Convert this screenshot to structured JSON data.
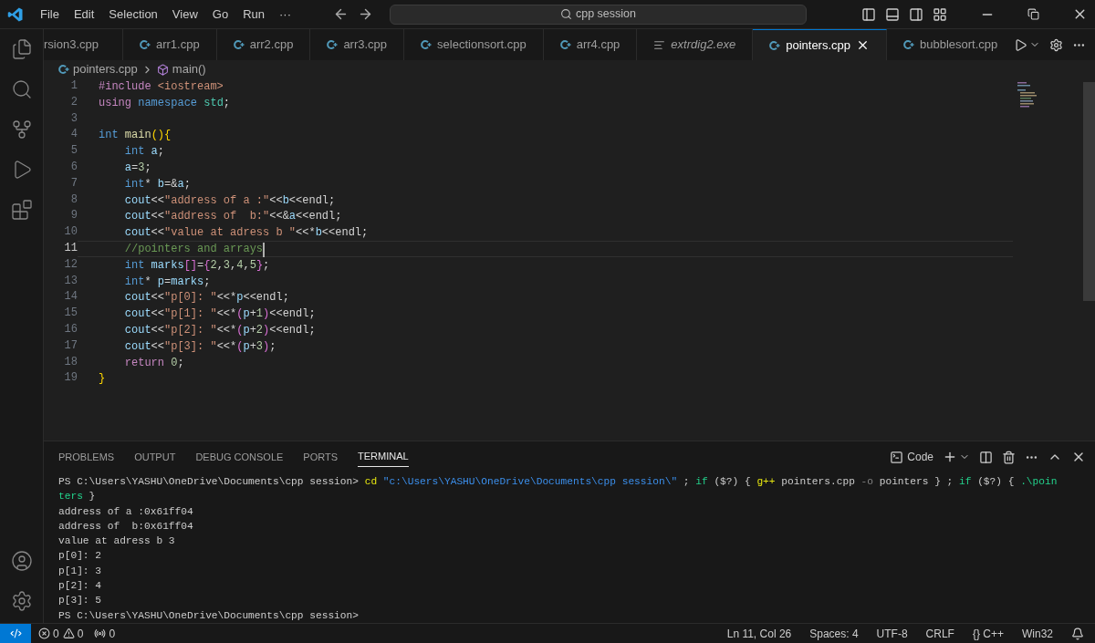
{
  "title_bar": {
    "menus": [
      "File",
      "Edit",
      "Selection",
      "View",
      "Go",
      "Run",
      "···"
    ],
    "search": "cpp session"
  },
  "tabs": [
    {
      "label": "rsion3.cpp",
      "kind": "cut",
      "selected": false,
      "preview": false
    },
    {
      "label": "arr1.cpp",
      "kind": "cpp",
      "selected": false,
      "preview": false
    },
    {
      "label": "arr2.cpp",
      "kind": "cpp",
      "selected": false,
      "preview": false
    },
    {
      "label": "arr3.cpp",
      "kind": "cpp",
      "selected": false,
      "preview": false
    },
    {
      "label": "selectionsort.cpp",
      "kind": "cpp",
      "selected": false,
      "preview": false
    },
    {
      "label": "arr4.cpp",
      "kind": "cpp",
      "selected": false,
      "preview": false
    },
    {
      "label": "extrdig2.exe",
      "kind": "text",
      "selected": false,
      "preview": true
    },
    {
      "label": "pointers.cpp",
      "kind": "cpp",
      "selected": true,
      "preview": false
    },
    {
      "label": "bubblesort.cpp",
      "kind": "cpp",
      "selected": false,
      "preview": false
    }
  ],
  "breadcrumb": [
    "pointers.cpp",
    "main()"
  ],
  "code_lines": [
    {
      "number": "1",
      "active": false,
      "tokens": [
        {
          "kind": "kw",
          "text": "#include"
        },
        {
          "kind": "str",
          "text": " <iostream>"
        }
      ]
    },
    {
      "number": "2",
      "active": false,
      "tokens": [
        {
          "kind": "kw",
          "text": "using"
        },
        {
          "kind": "type",
          "text": " namespace"
        },
        {
          "kind": "ns",
          "text": " std"
        },
        {
          "kind": "op",
          "text": ";"
        }
      ]
    },
    {
      "number": "3",
      "active": false
    },
    {
      "number": "4",
      "active": false,
      "tokens": [
        {
          "kind": "type",
          "text": "int"
        },
        {
          "kind": "fn",
          "text": " main"
        },
        {
          "kind": "br1",
          "text": "(){"
        }
      ]
    },
    {
      "number": "5",
      "active": false,
      "tokens": [
        {
          "kind": "type",
          "text": "    int"
        },
        {
          "kind": "var",
          "text": " a"
        },
        {
          "kind": "op",
          "text": ";"
        }
      ]
    },
    {
      "number": "6",
      "active": false,
      "tokens": [
        {
          "kind": "var",
          "text": "    a"
        },
        {
          "kind": "op",
          "text": "="
        },
        {
          "kind": "num",
          "text": "3"
        },
        {
          "kind": "op",
          "text": ";"
        }
      ]
    },
    {
      "number": "7",
      "active": false,
      "tokens": [
        {
          "kind": "type",
          "text": "    int"
        },
        {
          "kind": "op",
          "text": "* "
        },
        {
          "kind": "var",
          "text": "b"
        },
        {
          "kind": "op",
          "text": "=&"
        },
        {
          "kind": "var",
          "text": "a"
        },
        {
          "kind": "op",
          "text": ";"
        }
      ]
    },
    {
      "number": "8",
      "active": false,
      "tokens": [
        {
          "kind": "var",
          "text": "    cout"
        },
        {
          "kind": "op",
          "text": "<<"
        },
        {
          "kind": "str",
          "text": "\"address of a :\""
        },
        {
          "kind": "op",
          "text": "<<"
        },
        {
          "kind": "var",
          "text": "b"
        },
        {
          "kind": "op",
          "text": "<<endl;"
        }
      ]
    },
    {
      "number": "9",
      "active": false,
      "tokens": [
        {
          "kind": "var",
          "text": "    cout"
        },
        {
          "kind": "op",
          "text": "<<"
        },
        {
          "kind": "str",
          "text": "\"address of  b:\""
        },
        {
          "kind": "op",
          "text": "<<&"
        },
        {
          "kind": "var",
          "text": "a"
        },
        {
          "kind": "op",
          "text": "<<endl;"
        }
      ]
    },
    {
      "number": "10",
      "active": false,
      "tokens": [
        {
          "kind": "var",
          "text": "    cout"
        },
        {
          "kind": "op",
          "text": "<<"
        },
        {
          "kind": "str",
          "text": "\"value at adress b \""
        },
        {
          "kind": "op",
          "text": "<<*"
        },
        {
          "kind": "var",
          "text": "b"
        },
        {
          "kind": "op",
          "text": "<<endl;"
        }
      ]
    },
    {
      "number": "11",
      "active": true,
      "tokens": [
        {
          "kind": "cmt",
          "text": "    //pointers and arrays"
        }
      ]
    },
    {
      "number": "12",
      "active": false,
      "tokens": [
        {
          "kind": "type",
          "text": "    int"
        },
        {
          "kind": "var",
          "text": " marks"
        },
        {
          "kind": "br2",
          "text": "[]"
        },
        {
          "kind": "op",
          "text": "="
        },
        {
          "kind": "br2",
          "text": "{"
        },
        {
          "kind": "num",
          "text": "2"
        },
        {
          "kind": "op",
          "text": ","
        },
        {
          "kind": "num",
          "text": "3"
        },
        {
          "kind": "op",
          "text": ","
        },
        {
          "kind": "num",
          "text": "4"
        },
        {
          "kind": "op",
          "text": ","
        },
        {
          "kind": "num",
          "text": "5"
        },
        {
          "kind": "br2",
          "text": "}"
        },
        {
          "kind": "op",
          "text": ";"
        }
      ]
    },
    {
      "number": "13",
      "active": false,
      "tokens": [
        {
          "kind": "type",
          "text": "    int"
        },
        {
          "kind": "op",
          "text": "* "
        },
        {
          "kind": "var",
          "text": "p"
        },
        {
          "kind": "op",
          "text": "="
        },
        {
          "kind": "var",
          "text": "marks"
        },
        {
          "kind": "op",
          "text": ";"
        }
      ]
    },
    {
      "number": "14",
      "active": false,
      "tokens": [
        {
          "kind": "var",
          "text": "    cout"
        },
        {
          "kind": "op",
          "text": "<<"
        },
        {
          "kind": "str",
          "text": "\"p[0]: \""
        },
        {
          "kind": "op",
          "text": "<<*"
        },
        {
          "kind": "var",
          "text": "p"
        },
        {
          "kind": "op",
          "text": "<<endl;"
        }
      ]
    },
    {
      "number": "15",
      "active": false,
      "tokens": [
        {
          "kind": "var",
          "text": "    cout"
        },
        {
          "kind": "op",
          "text": "<<"
        },
        {
          "kind": "str",
          "text": "\"p[1]: \""
        },
        {
          "kind": "op",
          "text": "<<*"
        },
        {
          "kind": "br2",
          "text": "("
        },
        {
          "kind": "var",
          "text": "p"
        },
        {
          "kind": "op",
          "text": "+"
        },
        {
          "kind": "num",
          "text": "1"
        },
        {
          "kind": "br2",
          "text": ")"
        },
        {
          "kind": "op",
          "text": "<<endl;"
        }
      ]
    },
    {
      "number": "16",
      "active": false,
      "tokens": [
        {
          "kind": "var",
          "text": "    cout"
        },
        {
          "kind": "op",
          "text": "<<"
        },
        {
          "kind": "str",
          "text": "\"p[2]: \""
        },
        {
          "kind": "op",
          "text": "<<*"
        },
        {
          "kind": "br2",
          "text": "("
        },
        {
          "kind": "var",
          "text": "p"
        },
        {
          "kind": "op",
          "text": "+"
        },
        {
          "kind": "num",
          "text": "2"
        },
        {
          "kind": "br2",
          "text": ")"
        },
        {
          "kind": "op",
          "text": "<<endl;"
        }
      ]
    },
    {
      "number": "17",
      "active": false,
      "tokens": [
        {
          "kind": "var",
          "text": "    cout"
        },
        {
          "kind": "op",
          "text": "<<"
        },
        {
          "kind": "str",
          "text": "\"p[3]: \""
        },
        {
          "kind": "op",
          "text": "<<*"
        },
        {
          "kind": "br2",
          "text": "("
        },
        {
          "kind": "var",
          "text": "p"
        },
        {
          "kind": "op",
          "text": "+"
        },
        {
          "kind": "num",
          "text": "3"
        },
        {
          "kind": "br2",
          "text": ")"
        },
        {
          "kind": "op",
          "text": ";"
        }
      ]
    },
    {
      "number": "18",
      "active": false,
      "tokens": [
        {
          "kind": "kw",
          "text": "    return"
        },
        {
          "kind": "num",
          "text": " 0"
        },
        {
          "kind": "op",
          "text": ";"
        }
      ]
    },
    {
      "number": "19",
      "active": false,
      "tokens": [
        {
          "kind": "br1",
          "text": "}"
        }
      ]
    }
  ],
  "panel_tabs": [
    {
      "label": "PROBLEMS",
      "selected": false
    },
    {
      "label": "OUTPUT",
      "selected": false
    },
    {
      "label": "DEBUG CONSOLE",
      "selected": false
    },
    {
      "label": "PORTS",
      "selected": false
    },
    {
      "label": "TERMINAL",
      "selected": true
    }
  ],
  "terminal_name": "Code",
  "terminal_lines": [
    [
      {
        "kind": "plain",
        "text": "PS C:\\Users\\YASHU\\OneDrive\\Documents\\cpp session> "
      },
      {
        "kind": "cmd",
        "text": "cd"
      },
      {
        "kind": "str",
        "text": " \"c:\\Users\\YASHU\\OneDrive\\Documents\\cpp session\\\""
      },
      {
        "kind": "plain",
        "text": " ; "
      },
      {
        "kind": "kw",
        "text": "if"
      },
      {
        "kind": "plain",
        "text": " ($?) { "
      },
      {
        "kind": "cmd",
        "text": "g++"
      },
      {
        "kind": "plain",
        "text": " pointers.cpp "
      },
      {
        "kind": "dim",
        "text": "-o"
      },
      {
        "kind": "plain",
        "text": " pointers } ; "
      },
      {
        "kind": "kw",
        "text": "if"
      },
      {
        "kind": "plain",
        "text": " ($?) { "
      },
      {
        "kind": "kw",
        "text": ".\\poin"
      }
    ],
    [
      {
        "kind": "kw",
        "text": "ters"
      },
      {
        "kind": "plain",
        "text": " }"
      }
    ],
    [
      {
        "kind": "plain",
        "text": "address of a :0x61ff04"
      }
    ],
    [
      {
        "kind": "plain",
        "text": "address of  b:0x61ff04"
      }
    ],
    [
      {
        "kind": "plain",
        "text": "value at adress b 3"
      }
    ],
    [
      {
        "kind": "plain",
        "text": "p[0]: 2"
      }
    ],
    [
      {
        "kind": "plain",
        "text": "p[1]: 3"
      }
    ],
    [
      {
        "kind": "plain",
        "text": "p[2]: 4"
      }
    ],
    [
      {
        "kind": "plain",
        "text": "p[3]: 5"
      }
    ],
    [
      {
        "kind": "plain",
        "text": "PS C:\\Users\\YASHU\\OneDrive\\Documents\\cpp session>"
      }
    ]
  ],
  "status_bar": {
    "errors": "0",
    "warnings": "0",
    "ports": "0",
    "right": [
      "Ln 11, Col 26",
      "Spaces: 4",
      "UTF-8",
      "CRLF",
      "{} C++",
      "Win32"
    ]
  }
}
